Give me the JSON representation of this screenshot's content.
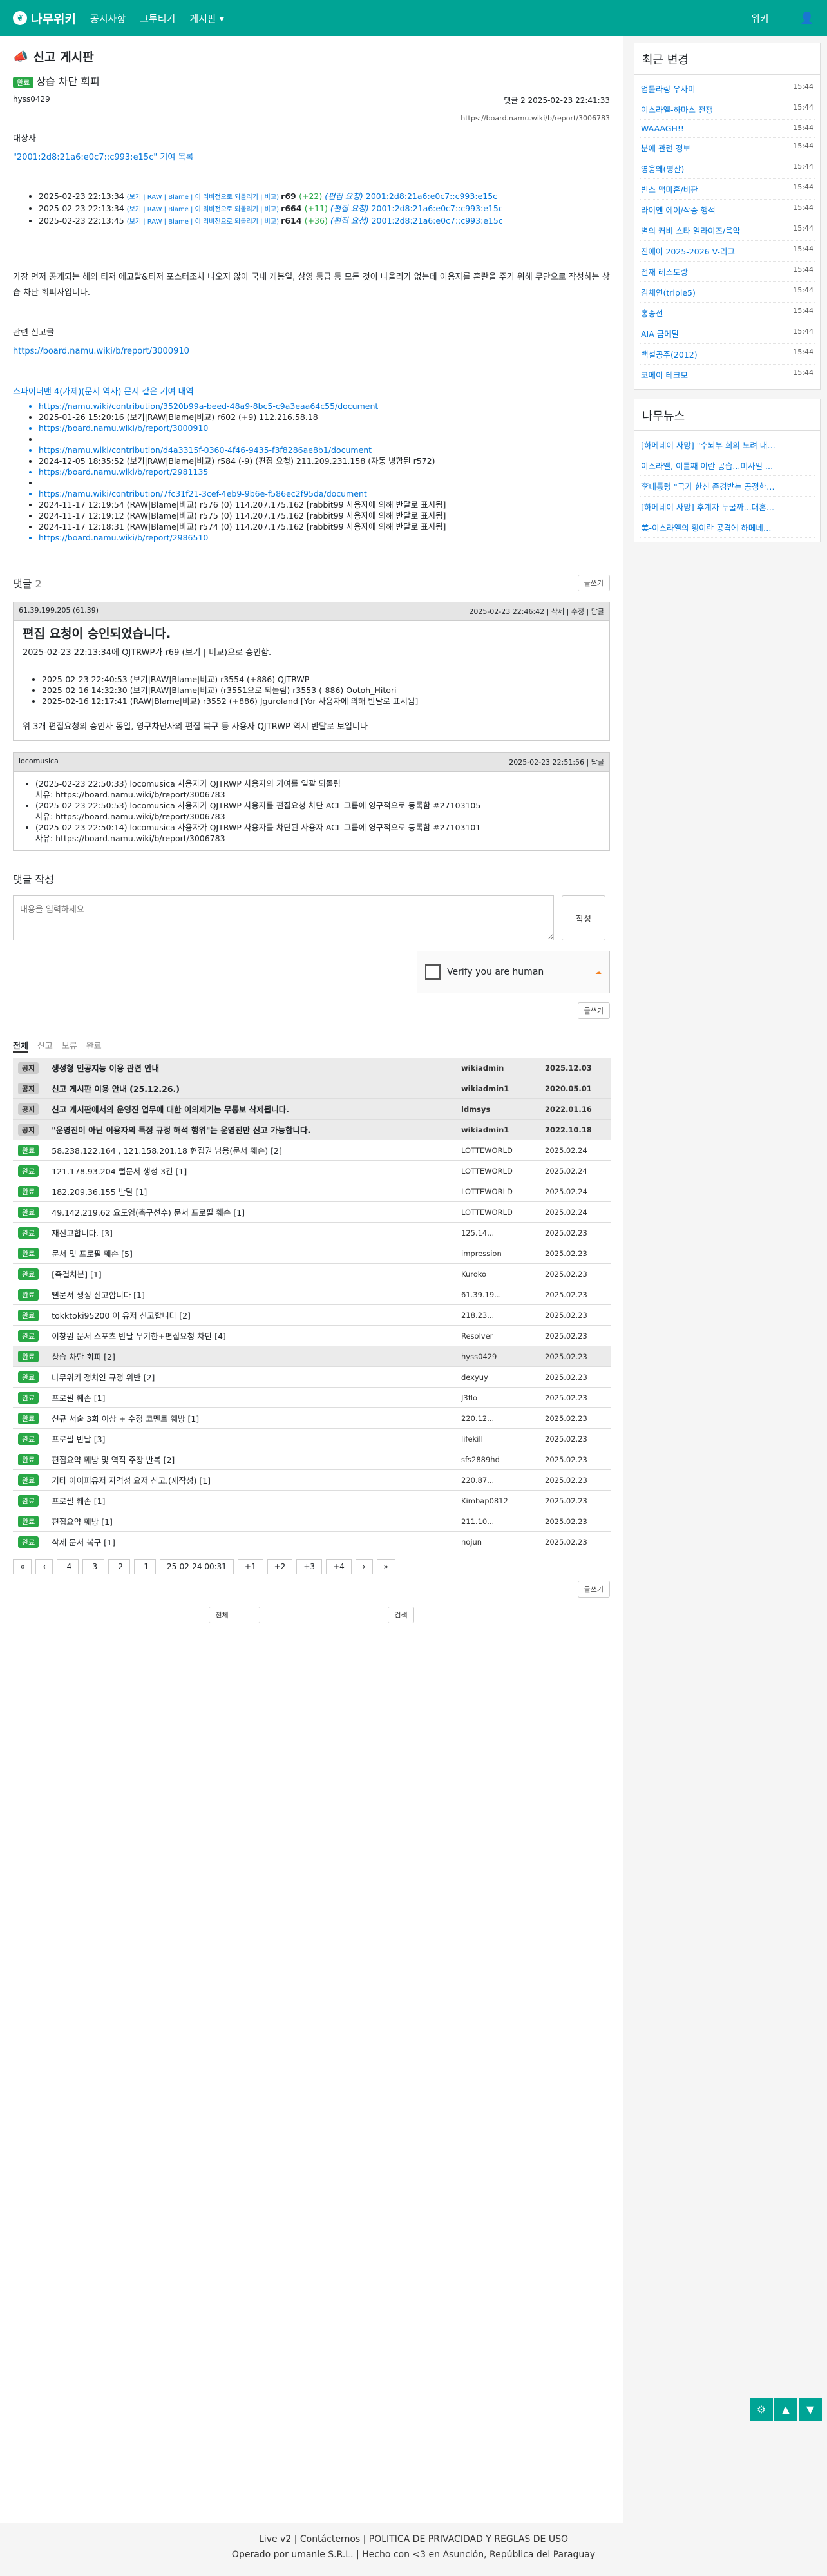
{
  "nav": {
    "logo": "나무위키",
    "items": [
      "공지사항",
      "그투티기",
      "게시판 ▾"
    ],
    "right": "위키"
  },
  "board": {
    "title": "신고 게시판"
  },
  "post": {
    "badge": "완료",
    "title": "상습 차단 회피",
    "author": "hyss0429",
    "meta": "댓글 2   2025-02-23 22:41:33",
    "url": "https://board.namu.wiki/b/report/3006783",
    "target_label": "대상자",
    "target": "\"2001:2d8:21a6:e0c7::c993:e15c\" 기여 목록",
    "revs": [
      {
        "date": "2025-02-23 22:13:34",
        "tools": "(보기 | RAW | Blame | 이 리비전으로 되돌리기 | 비교)",
        "rev": "r69",
        "diff": "(+22)",
        "note": "(편집 요청)",
        "ip": "2001:2d8:21a6:e0c7::c993:e15c"
      },
      {
        "date": "2025-02-23 22:13:34",
        "tools": "(보기 | RAW | Blame | 이 리비전으로 되돌리기 | 비교)",
        "rev": "r664",
        "diff": "(+11)",
        "note": "(편집 요청)",
        "ip": "2001:2d8:21a6:e0c7::c993:e15c"
      },
      {
        "date": "2025-02-23 22:13:45",
        "tools": "(보기 | RAW | Blame | 이 리비전으로 되돌리기 | 비교)",
        "rev": "r614",
        "diff": "(+36)",
        "note": "(편집 요청)",
        "ip": "2001:2d8:21a6:e0c7::c993:e15c"
      }
    ],
    "body1": "가장 먼저 공개되는 해외 티저 에고탈&티저 포스터조차 나오지 않아 국내 개봉일, 상영 등급 등 모든 것이 나올리가 없는데 이용자를 혼란을 주기 위해 무단으로 작성하는 상습 차단 회피자입니다.",
    "related_label": "관련 신고글",
    "related": "https://board.namu.wiki/b/report/3000910",
    "history_label": "스파이더맨 4(가제)(문서 역사) 문서 같은 기여 내역",
    "history": [
      "https://namu.wiki/contribution/3520b99a-beed-48a9-8bc5-c9a3eaa64c55/document",
      "2025-01-26 15:20:16 (보기|RAW|Blame|비교) r602 (+9) 112.216.58.18",
      "https://board.namu.wiki/b/report/3000910",
      "",
      "https://namu.wiki/contribution/d4a3315f-0360-4f46-9435-f3f8286ae8b1/document",
      "2024-12-05 18:35:52 (보기|RAW|Blame|비교) r584 (-9) (편집 요청) 211.209.231.158 (자동 병합된 r572)",
      "https://board.namu.wiki/b/report/2981135",
      "",
      "https://namu.wiki/contribution/7fc31f21-3cef-4eb9-9b6e-f586ec2f95da/document",
      "2024-11-17 12:19:54 (RAW|Blame|비교) r576 (0) 114.207.175.162 [rabbit99 사용자에 의해 반달로 표시됨]",
      "2024-11-17 12:19:12 (RAW|Blame|비교) r575 (0) 114.207.175.162 [rabbit99 사용자에 의해 반달로 표시됨]",
      "2024-11-17 12:18:31 (RAW|Blame|비교) r574 (0) 114.207.175.162 [rabbit99 사용자에 의해 반달로 표시됨]",
      "https://board.namu.wiki/b/report/2986510"
    ]
  },
  "comments": {
    "label": "댓글",
    "count": "2",
    "write_btn": "글쓰기",
    "c1": {
      "ip": "61.39.199.205 (61.39)",
      "date": "2025-02-23 22:46:42",
      "actions": "삭제 | 수정 | 답글",
      "title": "편집 요청이 승인되었습니다.",
      "line": "2025-02-23 22:13:34에 QJTRWP가 r69 (보기 | 비교)으로 승인함.",
      "revs": [
        "2025-02-23 22:40:53 (보기|RAW|Blame|비교) r3554 (+886) QJTRWP",
        "2025-02-16 14:32:30 (보기|RAW|Blame|비교) (r3551으로 되돌림) r3553 (-886) Ootoh_Hitori",
        "2025-02-16 12:17:41 (RAW|Blame|비교) r3552 (+886) Jguroland [Yor 사용자에 의해 반달로 표시됨]"
      ],
      "foot": "위 3개 편집요청의 승인자 동일, 영구차단자의 편집 복구 등 사용자 QJTRWP 역시 반달로 보입니다"
    },
    "c2": {
      "user": "locomusica",
      "date": "2025-02-23 22:51:56",
      "actions": "답글",
      "items": [
        "(2025-02-23 22:50:33) locomusica 사용자가 QJTRWP 사용자의 기여를 일괄 되돌림",
        "사유: https://board.namu.wiki/b/report/3006783",
        "(2025-02-23 22:50:53) locomusica 사용자가 QJTRWP 사용자를 편집요청 차단 ACL 그룹에 영구적으로 등록함 #27103105",
        "사유: https://board.namu.wiki/b/report/3006783",
        "(2025-02-23 22:50:14) locomusica 사용자가 QJTRWP 사용자를 차단된 사용자 ACL 그룹에 영구적으로 등록함 #27103101",
        "사유: https://board.namu.wiki/b/report/3006783"
      ]
    }
  },
  "write": {
    "label": "댓글 작성",
    "placeholder": "내용을 입력하세요",
    "submit": "작성",
    "captcha": "Verify you are human",
    "write_btn": "글쓰기"
  },
  "tabs": [
    "전체",
    "신고",
    "보류",
    "완료"
  ],
  "list": [
    {
      "tag": "공지",
      "title": "생성형 인공지능 이용 관련 안내",
      "user": "wikiadmin",
      "date": "2025.12.03",
      "notice": true
    },
    {
      "tag": "공지",
      "title": "신고 게시판 이용 안내 (25.12.26.)",
      "user": "wikiadmin1",
      "date": "2020.05.01",
      "notice": true
    },
    {
      "tag": "공지",
      "title": "신고 게시판에서의 운영진 업무에 대한 이의제기는 무통보 삭제됩니다.",
      "user": "ldmsys",
      "date": "2022.01.16",
      "notice": true
    },
    {
      "tag": "공지",
      "title": "\"운영진이 아닌 이용자의 특정 규정 해석 행위\"는 운영진만 신고 가능합니다.",
      "user": "wikiadmin1",
      "date": "2022.10.18",
      "notice": true
    },
    {
      "tag": "완료",
      "title": "58.238.122.164 , 121.158.201.18 현집권 남용(문서 훼손) [2]",
      "user": "LOTTEWORLD",
      "date": "2025.02.24"
    },
    {
      "tag": "완료",
      "title": "121.178.93.204 뻘문서 생성 3건 [1]",
      "user": "LOTTEWORLD",
      "date": "2025.02.24"
    },
    {
      "tag": "완료",
      "title": "182.209.36.155 반달 [1]",
      "user": "LOTTEWORLD",
      "date": "2025.02.24"
    },
    {
      "tag": "완료",
      "title": "49.142.219.62 요도염(축구선수) 문서 프로필 훼손 [1]",
      "user": "LOTTEWORLD",
      "date": "2025.02.24"
    },
    {
      "tag": "완료",
      "title": "재신고합니다. [3]",
      "user": "125.14...",
      "date": "2025.02.23"
    },
    {
      "tag": "완료",
      "title": "문서 및 프로필 훼손 [5]",
      "user": "impression",
      "date": "2025.02.23"
    },
    {
      "tag": "완료",
      "title": "[즉결처분] [1]",
      "user": "Kuroko",
      "date": "2025.02.23"
    },
    {
      "tag": "완료",
      "title": "뻘문서 생성 신고합니다 [1]",
      "user": "61.39.19...",
      "date": "2025.02.23"
    },
    {
      "tag": "완료",
      "title": "tokktoki95200 이 유저 신고합니다 [2]",
      "user": "218.23...",
      "date": "2025.02.23"
    },
    {
      "tag": "완료",
      "title": "이창원 문서 스포츠 반달 무기한+편집요청 차단 [4]",
      "user": "Resolver",
      "date": "2025.02.23"
    },
    {
      "tag": "완료",
      "title": "상습 차단 회피 [2]",
      "user": "hyss0429",
      "date": "2025.02.23",
      "current": true
    },
    {
      "tag": "완료",
      "title": "나무위키 정치인 규정 위반 [2]",
      "user": "dexyuy",
      "date": "2025.02.23"
    },
    {
      "tag": "완료",
      "title": "프로필 훼손 [1]",
      "user": "J3flo",
      "date": "2025.02.23"
    },
    {
      "tag": "완료",
      "title": "신규 서술 3회 이상 + 수정 코멘트 훼방 [1]",
      "user": "220.12...",
      "date": "2025.02.23"
    },
    {
      "tag": "완료",
      "title": "프로필 반달 [3]",
      "user": "lifekill",
      "date": "2025.02.23"
    },
    {
      "tag": "완료",
      "title": "편집요약 훼방 및 역직 주장 반복 [2]",
      "user": "sfs2889hd",
      "date": "2025.02.23"
    },
    {
      "tag": "완료",
      "title": "기타 아이피유저 자격성 요저 신고.(재작성) [1]",
      "user": "220.87...",
      "date": "2025.02.23"
    },
    {
      "tag": "완료",
      "title": "프로필 훼손 [1]",
      "user": "Kimbap0812",
      "date": "2025.02.23"
    },
    {
      "tag": "완료",
      "title": "편집요약 훼방 [1]",
      "user": "211.10...",
      "date": "2025.02.23"
    },
    {
      "tag": "완료",
      "title": "삭제 문서 복구 [1]",
      "user": "nojun",
      "date": "2025.02.23"
    }
  ],
  "pager": [
    "«",
    "‹",
    "-4",
    "-3",
    "-2",
    "-1",
    "25-02-24 00:31",
    "+1",
    "+2",
    "+3",
    "+4",
    "›",
    "»"
  ],
  "list_write": "글쓰기",
  "search": {
    "select": "전체",
    "button": "검색"
  },
  "sidebar": {
    "recent_title": "최근 변경",
    "recent": [
      [
        "업툴라링 우사미",
        "15:44"
      ],
      [
        "이스라엘-하마스 전쟁",
        "15:44"
      ],
      [
        "WAAAGH!!",
        "15:44"
      ],
      [
        "분에 관련 정보",
        "15:44"
      ],
      [
        "영웅왜(명산)",
        "15:44"
      ],
      [
        "빈스 맥마흔/비판",
        "15:44"
      ],
      [
        "라이엔 에이/작중 행적",
        "15:44"
      ],
      [
        "별의 커비 스타 얼라이즈/음악",
        "15:44"
      ],
      [
        "진에어 2025-2026 V-리그",
        "15:44"
      ],
      [
        "전재 레스토랑",
        "15:44"
      ],
      [
        "김채연(triple5)",
        "15:44"
      ],
      [
        "홍종선",
        "15:44"
      ],
      [
        "AIA 금메달",
        "15:44"
      ],
      [
        "백설공주(2012)",
        "15:44"
      ],
      [
        "코메이 테크모",
        "15:44"
      ]
    ],
    "news_title": "나무뉴스",
    "news": [
      "[하메네이 사망] \"수뇌부 회의 노려 대낮...",
      "이스라엘, 이틀째 이란 공습...미사일 발공...",
      "李대통령 \"국가 한신 존경받는 공정한 나...",
      "[하메네이 사망] 후계자 누굴까...대혼란 ...",
      "美-이스라엘의 횡이란 공격에 하메네이 사..."
    ]
  },
  "footer": {
    "line1": "Live v2 | Contácternos | POLITICA DE PRIVACIDAD Y REGLAS DE USO",
    "line2": "Operado por umanle S.R.L. | Hecho con <3 en Asunción, República del Paraguay"
  }
}
